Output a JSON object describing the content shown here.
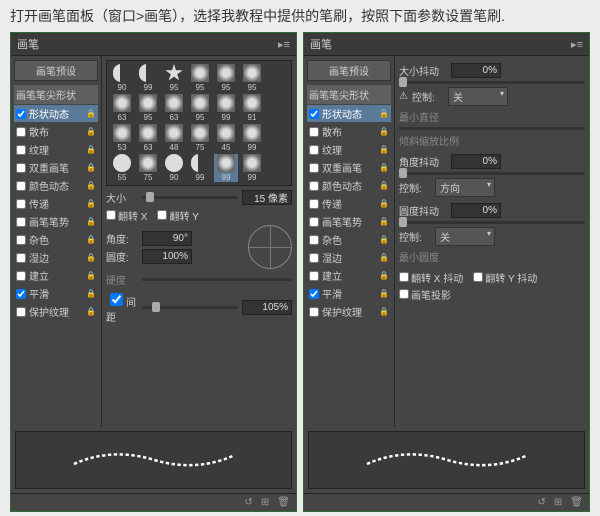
{
  "instruction": "打开画笔面板（窗口>画笔），选择我教程中提供的笔刷，按照下面参数设置笔刷.",
  "header": {
    "title": "画笔",
    "menu": "▸≡"
  },
  "sidebar": {
    "preset_btn": "画笔预设",
    "tip_shape": "画笔笔尖形状",
    "items": [
      {
        "label": "形状动态",
        "checked": true,
        "active": true
      },
      {
        "label": "散布",
        "checked": false
      },
      {
        "label": "纹理",
        "checked": false
      },
      {
        "label": "双重画笔",
        "checked": false
      },
      {
        "label": "颜色动态",
        "checked": false
      },
      {
        "label": "传递",
        "checked": false
      },
      {
        "label": "画笔笔势",
        "checked": false
      },
      {
        "label": "杂色",
        "checked": false
      },
      {
        "label": "湿边",
        "checked": false
      },
      {
        "label": "建立",
        "checked": false
      },
      {
        "label": "平滑",
        "checked": true
      },
      {
        "label": "保护纹理",
        "checked": false
      }
    ]
  },
  "left": {
    "brush_sizes": [
      "90",
      "99",
      "95",
      "95",
      "95",
      "95",
      "63",
      "95",
      "63",
      "95",
      "99",
      "91",
      "53",
      "63",
      "48",
      "75",
      "45",
      "99",
      "55",
      "75",
      "90",
      "99",
      "99",
      "99"
    ],
    "size_label": "大小",
    "size_value": "15 像素",
    "flip_x": "翻转 X",
    "flip_y": "翻转 Y",
    "angle_label": "角度:",
    "angle_value": "90°",
    "round_label": "圆度:",
    "round_value": "100%",
    "hardness_label": "硬度",
    "spacing_label": "间距",
    "spacing_value": "105%"
  },
  "right": {
    "size_jitter": "大小抖动",
    "size_jitter_val": "0%",
    "control_label": "控制:",
    "control_off": "关",
    "control_dir": "方向",
    "min_diam": "最小直径",
    "tilt_scale": "倾斜缩放比例",
    "angle_jitter": "角度抖动",
    "angle_jitter_val": "0%",
    "round_jitter": "圆度抖动",
    "round_jitter_val": "0%",
    "min_round": "最小圆度",
    "flip_x_jitter": "翻转 X 抖动",
    "flip_y_jitter": "翻转 Y 抖动",
    "brush_proj": "画笔投影"
  },
  "footer": {
    "i1": "↺",
    "i2": "⊞",
    "i3": "🗑"
  }
}
